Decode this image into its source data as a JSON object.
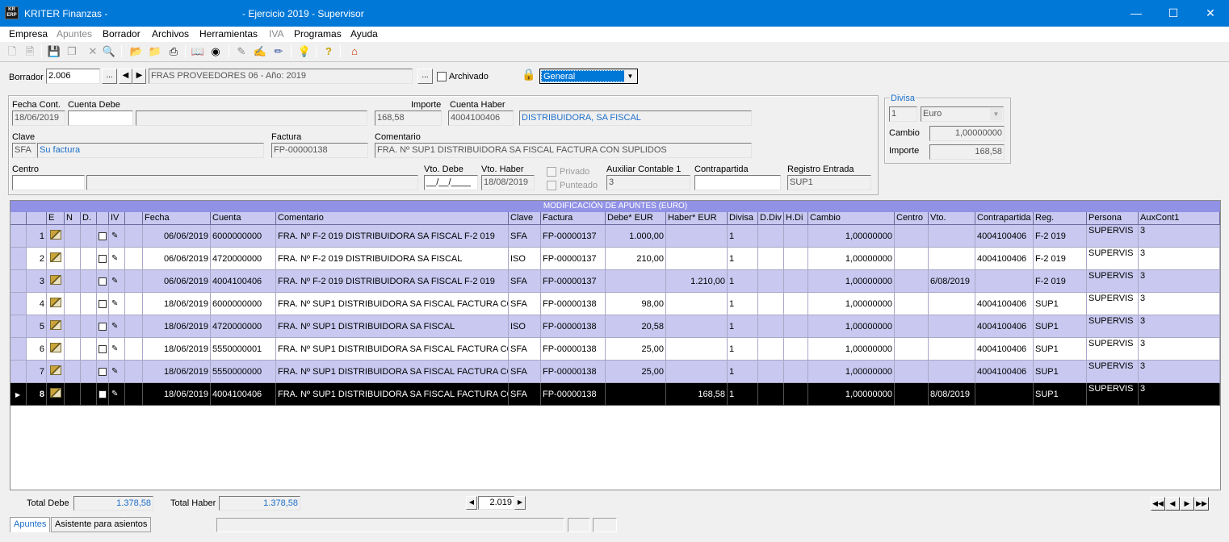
{
  "app": {
    "name": "KRITER Finanzas -",
    "logo": "KR ERP",
    "window_title": "- Ejercicio 2019 - Supervisor"
  },
  "menu": [
    "Empresa",
    "Apuntes",
    "Borrador",
    "Archivos",
    "Herramientas",
    "IVA",
    "Programas",
    "Ayuda"
  ],
  "menu_disabled": [
    "Apuntes",
    "IVA"
  ],
  "toolbar_icons": [
    "new-doc-icon",
    "copy-doc-icon",
    "save-icon",
    "duplicate-icon",
    "delete-icon",
    "preview-icon",
    "open-folder-icon",
    "folder-icon",
    "print-icon",
    "book-icon",
    "binoculars-icon",
    "pen-icon",
    "pen-edit-icon",
    "pen-multi-icon",
    "bulb-icon",
    "help-icon",
    "home-icon"
  ],
  "header": {
    "borrador_label": "Borrador",
    "borrador_value": "2.006",
    "borrador_desc": "FRAS PROVEEDORES 06 - Año: 2019",
    "archivado_label": "Archivado",
    "lock_icon": "lock-icon",
    "view_select": "General"
  },
  "form": {
    "fecha_cont_label": "Fecha Cont.",
    "fecha_cont": "18/06/2019",
    "cuenta_debe_label": "Cuenta Debe",
    "cuenta_debe": "",
    "cuenta_debe_desc": "",
    "importe_label": "Importe",
    "importe": "168,58",
    "cuenta_haber_label": "Cuenta Haber",
    "cuenta_haber": "4004100406",
    "cuenta_haber_desc": "DISTRIBUIDORA, SA FISCAL",
    "clave_label": "Clave",
    "clave": "SFA",
    "clave_desc": "Su factura",
    "factura_label": "Factura",
    "factura": "FP-00000138",
    "comentario_label": "Comentario",
    "comentario": "FRA. Nº SUP1 DISTRIBUIDORA  SA FISCAL FACTURA CON SUPLIDOS",
    "centro_label": "Centro",
    "centro": "",
    "centro_desc": "",
    "vto_debe_label": "Vto. Debe",
    "vto_debe": "__/__/____",
    "vto_haber_label": "Vto. Haber",
    "vto_haber": "18/08/2019",
    "privado_label": "Privado",
    "punteado_label": "Punteado",
    "aux_label": "Auxiliar Contable 1",
    "aux": "3",
    "contrapartida_label": "Contrapartida",
    "contrapartida": "",
    "registro_label": "Registro  Entrada",
    "registro": "SUP1"
  },
  "divisa": {
    "group_label": "Divisa",
    "code": "1",
    "name": "Euro",
    "cambio_label": "Cambio",
    "cambio": "1,00000000",
    "importe_label": "Importe",
    "importe": "168,58"
  },
  "grid": {
    "title": "MODIFICACIÓN DE APUNTES (EURO)",
    "columns": [
      "",
      "",
      "E",
      "N",
      "D.",
      "",
      "IV",
      "Fecha",
      "Cuenta",
      "Comentario",
      "Clave",
      "Factura",
      "Debe* EUR",
      "Haber* EUR",
      "Divisa",
      "D.Div",
      "H.Di",
      "Cambio",
      "Centro",
      "Vto.",
      "Contrapartida",
      "Reg.",
      "Persona",
      "AuxCont1"
    ],
    "rows": [
      {
        "n": "1",
        "fecha": "06/06/2019",
        "cuenta": "6000000000",
        "comentario": "FRA. Nº F-2 019 DISTRIBUIDORA  SA FISCAL F-2 019",
        "clave": "SFA",
        "factura": "FP-00000137",
        "debe": "1.000,00",
        "haber": "",
        "divisa": "1",
        "cambio": "1,00000000",
        "centro": "",
        "vto": "",
        "contra": "4004100406",
        "reg": "F-2 019",
        "persona": "SUPERVIS",
        "aux": "3"
      },
      {
        "n": "2",
        "fecha": "06/06/2019",
        "cuenta": "4720000000",
        "comentario": "FRA. Nº F-2 019 DISTRIBUIDORA  SA FISCAL",
        "clave": "ISO",
        "factura": "FP-00000137",
        "debe": "210,00",
        "haber": "",
        "divisa": "1",
        "cambio": "1,00000000",
        "centro": "",
        "vto": "",
        "contra": "4004100406",
        "reg": "F-2 019",
        "persona": "SUPERVIS",
        "aux": "3"
      },
      {
        "n": "3",
        "fecha": "06/06/2019",
        "cuenta": "4004100406",
        "comentario": "FRA. Nº F-2 019 DISTRIBUIDORA  SA FISCAL F-2 019",
        "clave": "SFA",
        "factura": "FP-00000137",
        "debe": "",
        "haber": "1.210,00",
        "divisa": "1",
        "cambio": "1,00000000",
        "centro": "",
        "vto": "6/08/2019",
        "contra": "",
        "reg": "F-2 019",
        "persona": "SUPERVIS",
        "aux": "3"
      },
      {
        "n": "4",
        "fecha": "18/06/2019",
        "cuenta": "6000000000",
        "comentario": "FRA. Nº SUP1 DISTRIBUIDORA  SA FISCAL FACTURA CO",
        "clave": "SFA",
        "factura": "FP-00000138",
        "debe": "98,00",
        "haber": "",
        "divisa": "1",
        "cambio": "1,00000000",
        "centro": "",
        "vto": "",
        "contra": "4004100406",
        "reg": "SUP1",
        "persona": "SUPERVIS",
        "aux": "3"
      },
      {
        "n": "5",
        "fecha": "18/06/2019",
        "cuenta": "4720000000",
        "comentario": "FRA. Nº SUP1 DISTRIBUIDORA  SA FISCAL",
        "clave": "ISO",
        "factura": "FP-00000138",
        "debe": "20,58",
        "haber": "",
        "divisa": "1",
        "cambio": "1,00000000",
        "centro": "",
        "vto": "",
        "contra": "4004100406",
        "reg": "SUP1",
        "persona": "SUPERVIS",
        "aux": "3"
      },
      {
        "n": "6",
        "fecha": "18/06/2019",
        "cuenta": "5550000001",
        "comentario": "FRA. Nº SUP1 DISTRIBUIDORA  SA FISCAL FACTURA CO",
        "clave": "SFA",
        "factura": "FP-00000138",
        "debe": "25,00",
        "haber": "",
        "divisa": "1",
        "cambio": "1,00000000",
        "centro": "",
        "vto": "",
        "contra": "4004100406",
        "reg": "SUP1",
        "persona": "SUPERVIS",
        "aux": "3"
      },
      {
        "n": "7",
        "fecha": "18/06/2019",
        "cuenta": "5550000000",
        "comentario": "FRA. Nº SUP1 DISTRIBUIDORA  SA FISCAL FACTURA CO",
        "clave": "SFA",
        "factura": "FP-00000138",
        "debe": "25,00",
        "haber": "",
        "divisa": "1",
        "cambio": "1,00000000",
        "centro": "",
        "vto": "",
        "contra": "4004100406",
        "reg": "SUP1",
        "persona": "SUPERVIS",
        "aux": "3"
      },
      {
        "n": "8",
        "fecha": "18/06/2019",
        "cuenta": "4004100406",
        "comentario": "FRA. Nº SUP1 DISTRIBUIDORA  SA FISCAL FACTURA CO",
        "clave": "SFA",
        "factura": "FP-00000138",
        "debe": "",
        "haber": "168,58",
        "divisa": "1",
        "cambio": "1,00000000",
        "centro": "",
        "vto": "8/08/2019",
        "contra": "",
        "reg": "SUP1",
        "persona": "SUPERVIS",
        "aux": "3"
      }
    ],
    "selected_row": 8
  },
  "totals": {
    "debe_label": "Total Debe",
    "debe": "1.378,58",
    "haber_label": "Total Haber",
    "haber": "1.378,58",
    "year": "2.019"
  },
  "tabs": [
    "Apuntes",
    "Asistente para asientos"
  ],
  "colors": {
    "titlebar": "#0078d7",
    "grid_header": "#c8c8f0",
    "grid_title": "#9191e6",
    "link_blue": "#1e6fc8"
  }
}
